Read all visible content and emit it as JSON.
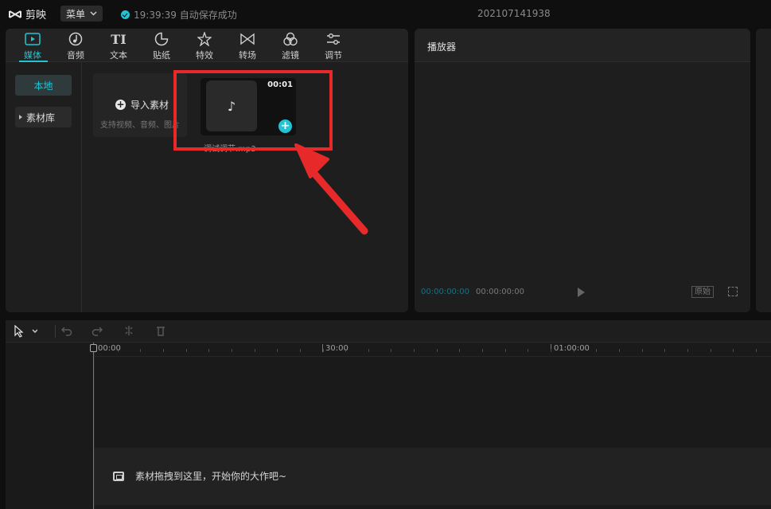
{
  "titlebar": {
    "app_name": "剪映",
    "menu_label": "菜单",
    "save_status": "19:39:39 自动保存成功",
    "project_name": "202107141938"
  },
  "toolbar": {
    "tabs": [
      {
        "label": "媒体",
        "icon": "media-icon",
        "active": true
      },
      {
        "label": "音频",
        "icon": "audio-icon"
      },
      {
        "label": "文本",
        "icon": "text-icon"
      },
      {
        "label": "贴纸",
        "icon": "sticker-icon"
      },
      {
        "label": "特效",
        "icon": "effects-icon"
      },
      {
        "label": "转场",
        "icon": "transition-icon"
      },
      {
        "label": "滤镜",
        "icon": "filter-icon"
      },
      {
        "label": "调节",
        "icon": "adjust-icon"
      }
    ],
    "text_icon_glyph": "TI"
  },
  "sidebar": {
    "items": [
      {
        "label": "本地",
        "active": true
      },
      {
        "label": "素材库"
      }
    ]
  },
  "import": {
    "label": "导入素材",
    "hint": "支持视频、音频、图片"
  },
  "media_item": {
    "duration": "00:01",
    "name": "调试调节.mp3"
  },
  "player": {
    "title": "播放器",
    "current_time": "00:00:00:00",
    "total_time": "00:00:00:00",
    "ratio_label": "原始"
  },
  "timeline": {
    "ticks": [
      "00:00",
      "30:00",
      "01:00:00"
    ],
    "empty_hint": "素材拖拽到这里，开始你的大作吧~"
  },
  "colors": {
    "accent": "#22c4d4",
    "highlight": "#e8292a",
    "background": "#0f0f0f",
    "panel": "#1e1e1e"
  }
}
